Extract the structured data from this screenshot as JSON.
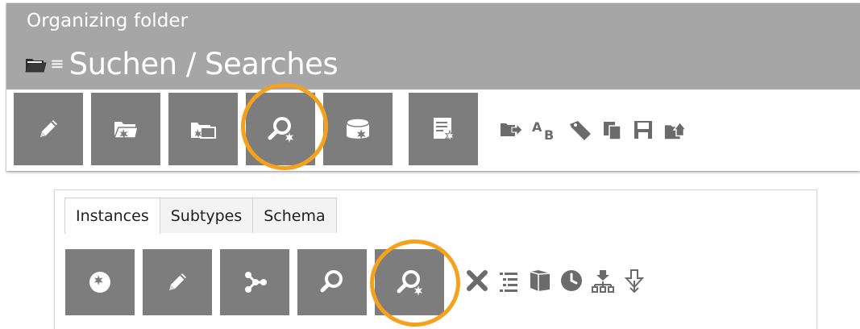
{
  "header": {
    "breadcrumb": "Organizing folder",
    "title": "Suchen / Searches",
    "title_icon": "folder-icon",
    "menu_glyph": "≡",
    "background_color": "#a6a6a6"
  },
  "top_toolbar": {
    "buttons": [
      {
        "name": "edit-button",
        "icon": "pencil-icon"
      },
      {
        "name": "new-folder-button",
        "icon": "new-folder-icon"
      },
      {
        "name": "new-subfolder-button",
        "icon": "new-folder-alt-icon"
      },
      {
        "name": "new-search-button",
        "icon": "search-new-icon",
        "highlighted": true
      },
      {
        "name": "new-database-button",
        "icon": "database-new-icon"
      },
      {
        "name": "new-document-button",
        "icon": "document-new-icon"
      }
    ],
    "small_icons": [
      "move-folder-icon",
      "rename-icon",
      "tag-icon",
      "copy-icon",
      "save-icon",
      "home-folder-icon"
    ]
  },
  "bottom_panel": {
    "tabs": [
      {
        "label": "Instances",
        "active": true
      },
      {
        "label": "Subtypes",
        "active": false
      },
      {
        "label": "Schema",
        "active": false
      }
    ],
    "toolbar": {
      "buttons": [
        {
          "name": "new-instance-button",
          "icon": "new-instance-icon"
        },
        {
          "name": "edit-button",
          "icon": "pencil-icon"
        },
        {
          "name": "graph-button",
          "icon": "graph-icon"
        },
        {
          "name": "search-button",
          "icon": "search-icon"
        },
        {
          "name": "new-search-button",
          "icon": "search-new-icon",
          "highlighted": true
        }
      ],
      "small_icons": [
        "delete-icon",
        "list-icon",
        "box-icon",
        "clock-icon",
        "hierarchy-import-icon",
        "import-icon"
      ]
    }
  },
  "colors": {
    "button_background": "#7d7d7d",
    "icon_light": "#ffffff",
    "icon_dark": "#6b6b6b",
    "highlight": "#f5a11b"
  }
}
